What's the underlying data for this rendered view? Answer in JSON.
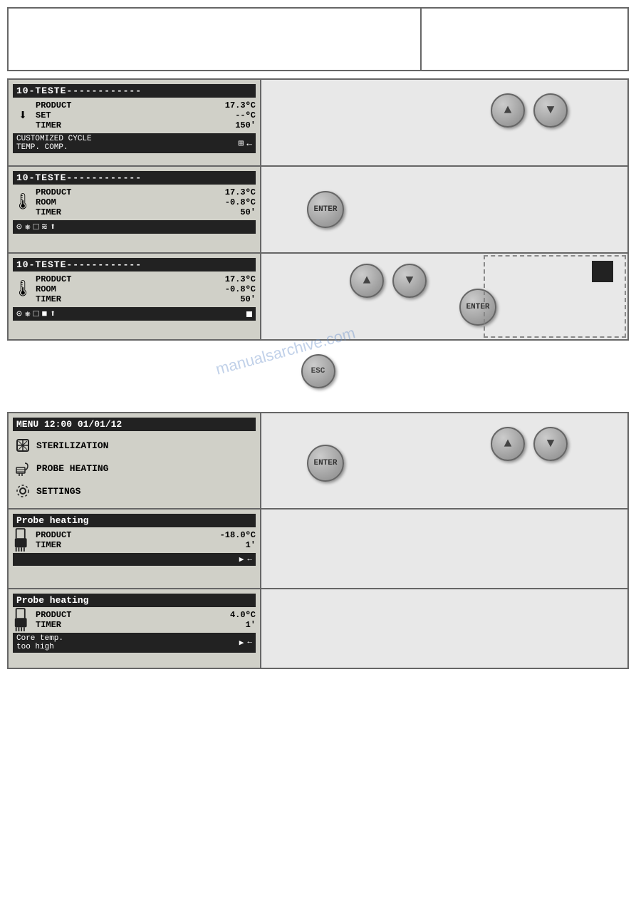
{
  "top_panel": {
    "left": "",
    "right": ""
  },
  "section1": {
    "header": "10-TESTE------------",
    "icon": "⬇",
    "rows": [
      {
        "label": "PRODUCT",
        "value": "17.3ºC"
      },
      {
        "label": "SET",
        "value": "--ºC"
      },
      {
        "label": "TIMER",
        "value": "150'"
      }
    ],
    "footer_label": "CUSTOMIZED CYCLE",
    "footer_sub": "TEMP.  COMP.",
    "footer_icons": [
      "⊞",
      "←"
    ],
    "controls": {
      "up_btn": "▲",
      "down_btn": "▼"
    }
  },
  "section2": {
    "header": "10-TESTE------------",
    "icon": "🌡",
    "rows": [
      {
        "label": "PRODUCT",
        "value": "17.3ºC"
      },
      {
        "label": "ROOM",
        "value": "-0.8ºC"
      },
      {
        "label": "TIMER",
        "value": "50'"
      }
    ],
    "footer_icons": [
      "⊙",
      "❋",
      "□",
      "≋",
      "⬆"
    ],
    "enter_label": "ENTER"
  },
  "section3": {
    "header": "10-TESTE------------",
    "icon": "🌡",
    "rows": [
      {
        "label": "PRODUCT",
        "value": "17.3ºC"
      },
      {
        "label": "ROOM",
        "value": "-0.8ºC"
      },
      {
        "label": "TIMER",
        "value": "50'"
      }
    ],
    "footer_icons": [
      "⊙",
      "❋",
      "□",
      "■",
      "⬆"
    ],
    "controls": {
      "up_btn": "▲",
      "down_btn": "▼",
      "enter_label": "ENTER"
    }
  },
  "esc_button": {
    "label": "ESC"
  },
  "menu_section": {
    "header": "MENU  12:00  01/01/12",
    "items": [
      {
        "icon": "⚙",
        "label": "STERILIZATION"
      },
      {
        "icon": "♨",
        "label": "PROBE HEATING"
      },
      {
        "icon": "⚙",
        "label": "SETTINGS"
      }
    ],
    "controls": {
      "up_btn": "▲",
      "down_btn": "▼",
      "enter_label": "ENTER"
    }
  },
  "probe1": {
    "header": "Probe heating",
    "icon": "↱",
    "rows": [
      {
        "label": "PRODUCT",
        "value": "-18.0ºC"
      },
      {
        "label": "TIMER",
        "value": "1'"
      }
    ],
    "footer_icons": [
      "▶",
      "←"
    ]
  },
  "probe2": {
    "header": "Probe heating",
    "icon": "↱",
    "rows": [
      {
        "label": "PRODUCT",
        "value": "4.0ºC"
      },
      {
        "label": "TIMER",
        "value": "1'"
      }
    ],
    "footer_label": "Core temp.",
    "footer_sub": "too high",
    "footer_icons": [
      "▶",
      "←"
    ]
  },
  "watermark": "manualsarchive.com"
}
